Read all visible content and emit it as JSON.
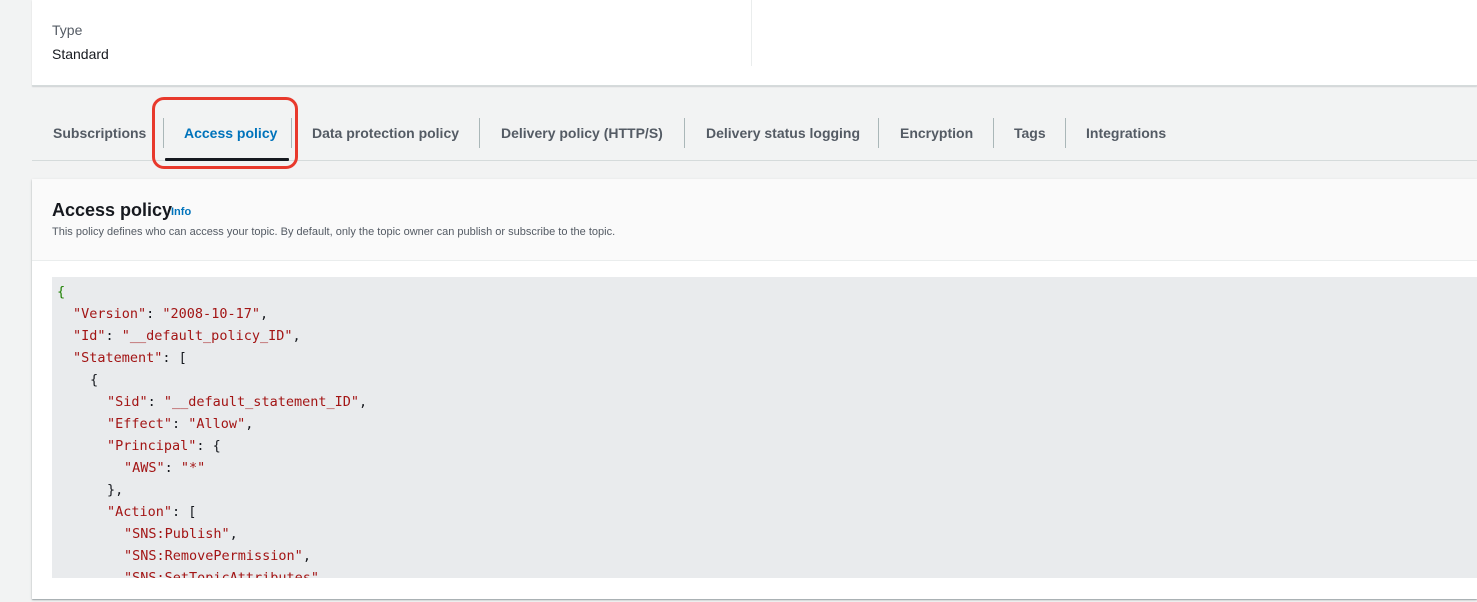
{
  "details": {
    "type_label": "Type",
    "type_value": "Standard"
  },
  "tabs": [
    {
      "label": "Subscriptions",
      "active": false
    },
    {
      "label": "Access policy",
      "active": true
    },
    {
      "label": "Data protection policy",
      "active": false
    },
    {
      "label": "Delivery policy (HTTP/S)",
      "active": false
    },
    {
      "label": "Delivery status logging",
      "active": false
    },
    {
      "label": "Encryption",
      "active": false
    },
    {
      "label": "Tags",
      "active": false
    },
    {
      "label": "Integrations",
      "active": false
    }
  ],
  "policy": {
    "title": "Access policy",
    "info_label": "Info",
    "description": "This policy defines who can access your topic. By default, only the topic owner can publish or subscribe to the topic.",
    "code": {
      "open_brace": "{",
      "version_key": "\"Version\"",
      "version_value": "\"2008-10-17\"",
      "id_key": "\"Id\"",
      "id_value": "\"__default_policy_ID\"",
      "statement_key": "\"Statement\"",
      "statement_open": "[",
      "stmt_open_brace": "{",
      "sid_key": "\"Sid\"",
      "sid_value": "\"__default_statement_ID\"",
      "effect_key": "\"Effect\"",
      "effect_value": "\"Allow\"",
      "principal_key": "\"Principal\"",
      "principal_open": "{",
      "aws_key": "\"AWS\"",
      "aws_value": "\"*\"",
      "principal_close": "},",
      "action_key": "\"Action\"",
      "action_open": "[",
      "action_1": "\"SNS:Publish\"",
      "action_2": "\"SNS:RemovePermission\"",
      "action_3": "\"SNS:SetTopicAttributes\""
    }
  },
  "colors": {
    "accent": "#0073bb",
    "highlight": "#e8392c",
    "json_key": "#a31515",
    "json_brace": "#1d8102"
  }
}
